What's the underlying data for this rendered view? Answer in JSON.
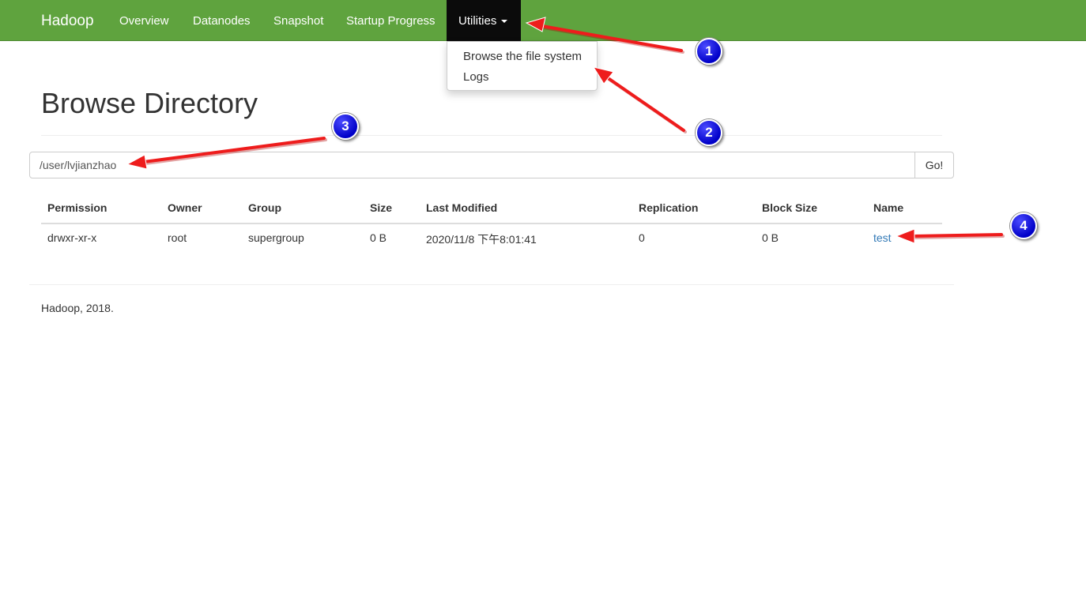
{
  "navbar": {
    "brand": "Hadoop",
    "items": [
      "Overview",
      "Datanodes",
      "Snapshot",
      "Startup Progress"
    ],
    "active_item": "Utilities",
    "bg_color": "#5fa33e"
  },
  "dropdown": {
    "items": [
      "Browse the file system",
      "Logs"
    ]
  },
  "page": {
    "title": "Browse Directory"
  },
  "path_form": {
    "value": "/user/lvjianzhao",
    "button_label": "Go!"
  },
  "table": {
    "headers": [
      "Permission",
      "Owner",
      "Group",
      "Size",
      "Last Modified",
      "Replication",
      "Block Size",
      "Name"
    ],
    "rows": [
      [
        "drwxr-xr-x",
        "root",
        "supergroup",
        "0 B",
        "2020/11/8 下午8:01:41",
        "0",
        "0 B",
        "test"
      ]
    ]
  },
  "footer": {
    "text": "Hadoop, 2018."
  },
  "annotations": {
    "badges": [
      "1",
      "2",
      "3",
      "4"
    ],
    "arrow_color": "#ee1c1c",
    "badge_color": "#0000c8"
  }
}
